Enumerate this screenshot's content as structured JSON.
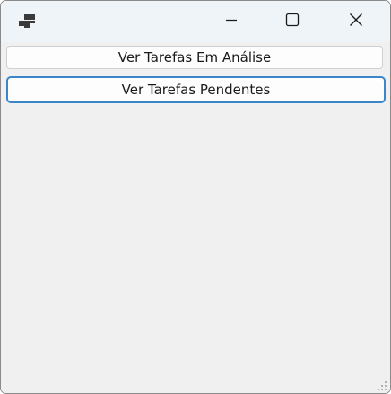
{
  "window": {
    "title": "",
    "icon": "app-windows-icon"
  },
  "caption_buttons": {
    "minimize_icon": "minimize-icon",
    "maximize_icon": "maximize-icon",
    "close_icon": "close-icon"
  },
  "buttons": {
    "analise_label": "Ver Tarefas Em Análise",
    "pendentes_label": "Ver Tarefas Pendentes"
  },
  "colors": {
    "titlebar": "#eff4f9",
    "client": "#f0f0f0",
    "focus_border": "#3a86c8"
  }
}
